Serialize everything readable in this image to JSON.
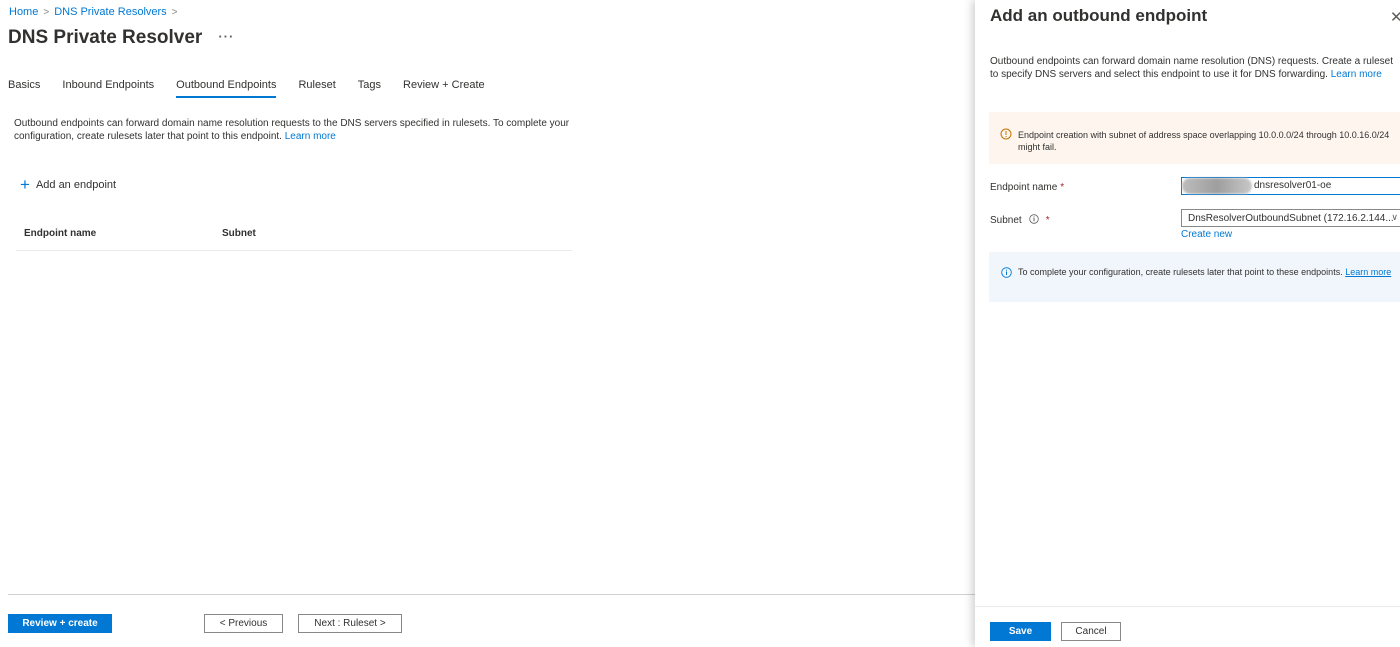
{
  "breadcrumb": {
    "home": "Home",
    "resolvers": "DNS Private Resolvers",
    "sep": ">"
  },
  "page": {
    "title": "DNS Private Resolver",
    "more": "···"
  },
  "tabs": [
    {
      "label": "Basics",
      "active": false
    },
    {
      "label": "Inbound Endpoints",
      "active": false
    },
    {
      "label": "Outbound Endpoints",
      "active": true
    },
    {
      "label": "Ruleset",
      "active": false
    },
    {
      "label": "Tags",
      "active": false
    },
    {
      "label": "Review + Create",
      "active": false
    }
  ],
  "description": {
    "text": "Outbound endpoints can forward domain name resolution requests to the DNS servers specified in rulesets. To complete your configuration, create rulesets later that point to this endpoint.",
    "learn_more": "Learn more"
  },
  "add_endpoint": {
    "icon": "plus-icon",
    "label": "Add an endpoint"
  },
  "table": {
    "columns": [
      "Endpoint name",
      "Subnet"
    ],
    "rows": []
  },
  "footer": {
    "review_create": "Review + create",
    "previous": "< Previous",
    "next": "Next : Ruleset >"
  },
  "panel": {
    "title": "Add an outbound endpoint",
    "close": "✕",
    "description": "Outbound endpoints can forward domain name resolution (DNS) requests. Create a ruleset to specify DNS servers and select this endpoint to use it for DNS forwarding.",
    "learn_more": "Learn more",
    "warning": "Endpoint creation with subnet of address space overlapping 10.0.0.0/24 through 10.0.16.0/24 might fail.",
    "endpoint_name_label": "Endpoint name",
    "endpoint_name_value": "dnsresolver01-oe",
    "subnet_label": "Subnet",
    "subnet_value": "DnsResolverOutboundSubnet (172.16.2.144...",
    "create_new": "Create new",
    "info_text": "To complete your configuration, create rulesets later that point to these endpoints.",
    "info_learn": "Learn more",
    "save": "Save",
    "cancel": "Cancel",
    "required_mark": "*"
  },
  "colors": {
    "accent": "#0078d4",
    "warning_bg": "#fdf5ee",
    "info_bg": "#f0f6fb"
  }
}
